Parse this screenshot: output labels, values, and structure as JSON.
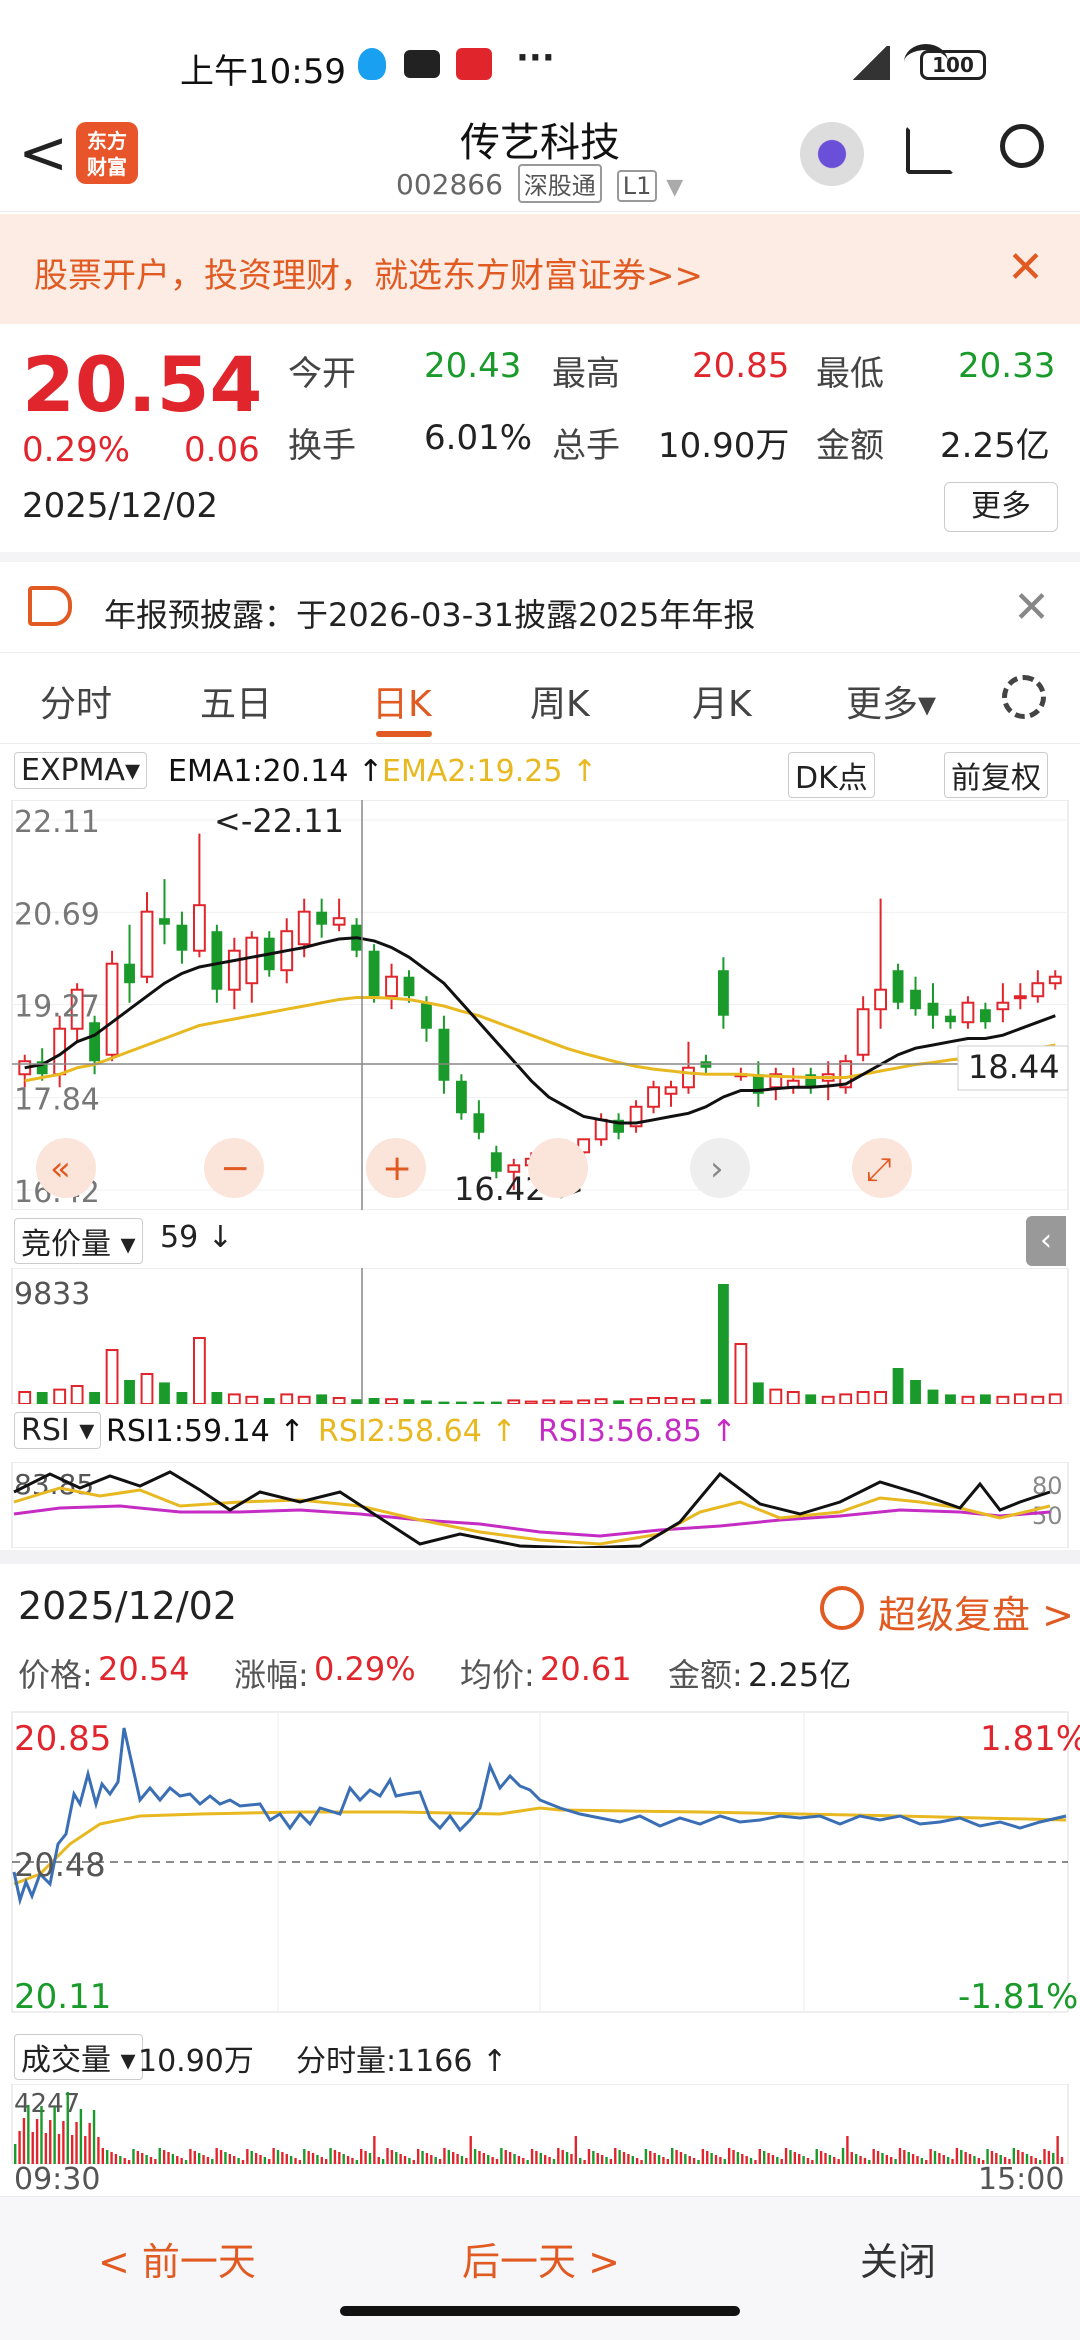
{
  "status_bar": {
    "time": "上午10:59",
    "battery": "100",
    "more": "···"
  },
  "nav": {
    "title": "传艺科技",
    "code": "002866",
    "tag1": "深股通",
    "tag2": "L1",
    "logo_text": "东方\n财富",
    "back": "<"
  },
  "banner": {
    "text": "股票开户，投资理财，就选东方财富证券>>",
    "close": "✕"
  },
  "quote": {
    "price": "20.54",
    "change_pct": "0.29%",
    "change": "0.06",
    "date": "2025/12/02",
    "open_label": "今开",
    "open": "20.43",
    "high_label": "最高",
    "high": "20.85",
    "low_label": "最低",
    "low": "20.33",
    "turnover_label": "换手",
    "turnover": "6.01%",
    "volume_label": "总手",
    "volume": "10.90万",
    "amount_label": "金额",
    "amount": "2.25亿",
    "more": "更多"
  },
  "notice": {
    "text": "年报预披露：于2026-03-31披露2025年年报",
    "close": "✕"
  },
  "tabs": [
    "分时",
    "五日",
    "日K",
    "周K",
    "月K",
    "更多▾"
  ],
  "kline": {
    "indicator": "EXPMA▾",
    "ema1": "EMA1:20.14 ↑",
    "ema2": "EMA2:19.25 ↑",
    "dk": "DK点",
    "adj": "前复权",
    "y_labels": [
      "22.11",
      "20.69",
      "19.27",
      "17.84",
      "16.42"
    ],
    "max_label": "<-22.11",
    "min_label": "16.42->",
    "last_label": "18.44"
  },
  "volume_panel": {
    "indicator": "竞价量 ▾",
    "value": "59 ↓",
    "max": "9833"
  },
  "rsi_panel": {
    "indicator": "RSI ▾",
    "rsi1": "RSI1:59.14 ↑",
    "rsi2": "RSI2:58.64 ↑",
    "rsi3": "RSI3:56.85 ↑",
    "top": "83.85",
    "r80": "80",
    "r50": "50"
  },
  "detail": {
    "date": "2025/12/02",
    "replay": "超级复盘 >",
    "price_label": "价格:",
    "price": "20.54",
    "chg_label": "涨幅:",
    "chg": "0.29%",
    "avg_label": "均价:",
    "avg": "20.61",
    "amt_label": "金额:",
    "amt": "2.25亿",
    "hi": "20.85",
    "mid": "20.48",
    "lo": "20.11",
    "hi_pct": "1.81%",
    "lo_pct": "-1.81%",
    "vol_indicator": "成交量 ▾",
    "vol_value": "10.90万",
    "tick_label": "分时量:1166 ↑",
    "vol_max": "4247",
    "t_start": "09:30",
    "t_end": "15:00"
  },
  "bottom": {
    "prev": "< 前一天",
    "next": "后一天 >",
    "close": "关闭"
  },
  "colors": {
    "up": "#e0262c",
    "down": "#1a9a2a",
    "accent": "#e05a22",
    "ema1": "#111111",
    "ema2": "#e8b820",
    "rsi3": "#c42cc4"
  },
  "chart_data": [
    {
      "type": "candlestick",
      "ylim": [
        16.42,
        22.11
      ],
      "candles": [
        [
          18.2,
          18.5,
          18.0,
          18.4
        ],
        [
          18.4,
          18.6,
          18.1,
          18.2
        ],
        [
          18.2,
          19.1,
          18.0,
          18.9
        ],
        [
          18.9,
          19.6,
          18.7,
          19.5
        ],
        [
          19.0,
          19.1,
          18.2,
          18.4
        ],
        [
          18.5,
          20.1,
          18.4,
          19.9
        ],
        [
          19.9,
          20.5,
          19.3,
          19.6
        ],
        [
          19.7,
          21.0,
          19.6,
          20.7
        ],
        [
          20.6,
          21.2,
          20.2,
          20.5
        ],
        [
          20.5,
          20.7,
          19.9,
          20.1
        ],
        [
          20.1,
          21.9,
          20.0,
          20.8
        ],
        [
          20.4,
          20.5,
          19.3,
          19.5
        ],
        [
          19.5,
          20.3,
          19.2,
          20.1
        ],
        [
          19.6,
          20.4,
          19.3,
          20.3
        ],
        [
          20.3,
          20.4,
          19.7,
          19.8
        ],
        [
          19.8,
          20.6,
          19.6,
          20.4
        ],
        [
          20.2,
          20.9,
          20.0,
          20.7
        ],
        [
          20.7,
          20.9,
          20.3,
          20.5
        ],
        [
          20.5,
          20.9,
          20.4,
          20.6
        ],
        [
          20.5,
          20.6,
          20.0,
          20.1
        ],
        [
          20.1,
          20.2,
          19.3,
          19.4
        ],
        [
          19.4,
          19.9,
          19.2,
          19.7
        ],
        [
          19.7,
          19.8,
          19.3,
          19.4
        ],
        [
          19.3,
          19.4,
          18.7,
          18.9
        ],
        [
          18.9,
          19.1,
          17.9,
          18.1
        ],
        [
          18.1,
          18.2,
          17.5,
          17.6
        ],
        [
          17.6,
          17.8,
          17.2,
          17.3
        ],
        [
          17.0,
          17.1,
          16.6,
          16.7
        ],
        [
          16.7,
          16.9,
          16.42,
          16.8
        ],
        [
          16.8,
          17.0,
          16.6,
          16.9
        ],
        [
          16.9,
          17.1,
          16.7,
          17.0
        ],
        [
          17.0,
          17.2,
          16.9,
          17.1
        ],
        [
          17.0,
          17.2,
          16.9,
          17.2
        ],
        [
          17.2,
          17.6,
          17.1,
          17.5
        ],
        [
          17.5,
          17.6,
          17.2,
          17.3
        ],
        [
          17.4,
          17.8,
          17.3,
          17.7
        ],
        [
          17.7,
          18.1,
          17.6,
          18.0
        ],
        [
          17.9,
          18.1,
          17.7,
          18.0
        ],
        [
          18.0,
          18.7,
          17.9,
          18.3
        ],
        [
          18.4,
          18.5,
          18.2,
          18.3
        ],
        [
          19.8,
          20.0,
          18.9,
          19.1
        ],
        [
          18.2,
          18.3,
          18.1,
          18.2
        ],
        [
          18.2,
          18.4,
          17.7,
          17.9
        ],
        [
          18.0,
          18.3,
          17.8,
          18.2
        ],
        [
          18.0,
          18.3,
          17.9,
          18.1
        ],
        [
          18.2,
          18.3,
          17.9,
          18.0
        ],
        [
          18.1,
          18.4,
          17.8,
          18.2
        ],
        [
          18.0,
          18.5,
          17.9,
          18.4
        ],
        [
          18.5,
          19.4,
          18.4,
          19.2
        ],
        [
          19.2,
          20.9,
          18.9,
          19.5
        ],
        [
          19.8,
          19.9,
          19.2,
          19.3
        ],
        [
          19.5,
          19.7,
          19.1,
          19.2
        ],
        [
          19.3,
          19.6,
          18.9,
          19.1
        ],
        [
          19.1,
          19.2,
          18.9,
          19.0
        ],
        [
          19.0,
          19.4,
          18.9,
          19.3
        ],
        [
          19.2,
          19.3,
          18.9,
          19.0
        ],
        [
          19.2,
          19.6,
          19.0,
          19.3
        ],
        [
          19.4,
          19.6,
          19.2,
          19.4
        ],
        [
          19.4,
          19.8,
          19.3,
          19.6
        ],
        [
          19.6,
          19.8,
          19.5,
          19.7
        ]
      ],
      "ema1": [
        18.3,
        18.35,
        18.5,
        18.7,
        18.8,
        19.0,
        19.2,
        19.4,
        19.6,
        19.75,
        19.85,
        19.9,
        19.95,
        20.0,
        20.05,
        20.1,
        20.15,
        20.22,
        20.28,
        20.3,
        20.25,
        20.15,
        20.0,
        19.8,
        19.6,
        19.3,
        19.0,
        18.7,
        18.4,
        18.1,
        17.85,
        17.7,
        17.55,
        17.5,
        17.45,
        17.45,
        17.5,
        17.55,
        17.6,
        17.7,
        17.85,
        17.95,
        17.95,
        17.98,
        18.0,
        18.0,
        18.02,
        18.05,
        18.2,
        18.35,
        18.5,
        18.6,
        18.65,
        18.7,
        18.75,
        18.75,
        18.8,
        18.9,
        19.0,
        19.1
      ],
      "ema2": [
        18.1,
        18.15,
        18.2,
        18.3,
        18.35,
        18.45,
        18.55,
        18.65,
        18.75,
        18.85,
        18.95,
        19.0,
        19.05,
        19.1,
        19.15,
        19.2,
        19.25,
        19.3,
        19.35,
        19.38,
        19.38,
        19.37,
        19.35,
        19.3,
        19.25,
        19.17,
        19.1,
        19.0,
        18.9,
        18.8,
        18.7,
        18.6,
        18.52,
        18.45,
        18.38,
        18.32,
        18.28,
        18.25,
        18.22,
        18.2,
        18.2,
        18.2,
        18.18,
        18.17,
        18.16,
        18.15,
        18.15,
        18.15,
        18.2,
        18.25,
        18.3,
        18.35,
        18.38,
        18.42,
        18.45,
        18.48,
        18.52,
        18.56,
        18.6,
        18.65
      ]
    }
  ]
}
